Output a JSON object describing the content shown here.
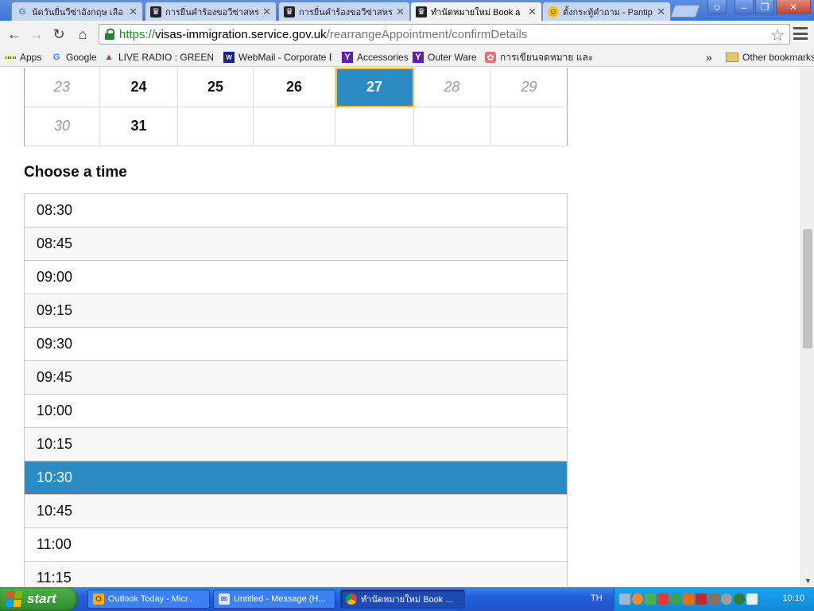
{
  "browser": {
    "tabs": [
      {
        "title": "นัดวันยื่นวีซ่าอังกฤษ เลือ",
        "icon": "google-icon"
      },
      {
        "title": "การยื่นคำร้องขอวีซ่าสหร",
        "icon": "crown-icon"
      },
      {
        "title": "การยื่นคำร้องขอวีซ่าสหร",
        "icon": "crown-icon"
      },
      {
        "title": "ทำนัดหมายใหม่ Book a",
        "icon": "crown-icon"
      },
      {
        "title": "ตั้งกระทู้คำถาม - Pantip",
        "icon": "emoji-icon"
      }
    ],
    "window_controls": {
      "minimize": "–",
      "maximize": "❐",
      "close": "✕"
    },
    "url": {
      "scheme": "https://",
      "host": "visas-immigration.service.gov.uk",
      "path": "/rearrangeAppointment/confirmDetails"
    },
    "bookmarks": [
      {
        "label": "Apps"
      },
      {
        "label": "Google"
      },
      {
        "label": "LIVE RADIO : GREEN W/"
      },
      {
        "label": "WebMail - Corporate Edi"
      },
      {
        "label": "Accessories"
      },
      {
        "label": "Outer Ware"
      },
      {
        "label": "การเขียนจดหมาย และอีเม"
      }
    ],
    "bookmarks_overflow": "»",
    "other_bookmarks": "Other bookmarks"
  },
  "calendar": {
    "rows": [
      [
        {
          "day": "23",
          "state": "off"
        },
        {
          "day": "24",
          "state": "on"
        },
        {
          "day": "25",
          "state": "on"
        },
        {
          "day": "26",
          "state": "on"
        },
        {
          "day": "27",
          "state": "selected"
        },
        {
          "day": "28",
          "state": "off"
        },
        {
          "day": "29",
          "state": "off"
        }
      ],
      [
        {
          "day": "30",
          "state": "off"
        },
        {
          "day": "31",
          "state": "on"
        },
        {
          "day": "",
          "state": "empty"
        },
        {
          "day": "",
          "state": "empty"
        },
        {
          "day": "",
          "state": "empty"
        },
        {
          "day": "",
          "state": "empty"
        },
        {
          "day": "",
          "state": "empty"
        }
      ]
    ]
  },
  "time_section": {
    "heading": "Choose a time",
    "slots": [
      "08:30",
      "08:45",
      "09:00",
      "09:15",
      "09:30",
      "09:45",
      "10:00",
      "10:15",
      "10:30",
      "10:45",
      "11:00",
      "11:15"
    ],
    "selected": "10:30"
  },
  "taskbar": {
    "start_label": "start",
    "tasks": [
      {
        "label": "Outlook Today - Micr...",
        "icon": "outlook-icon"
      },
      {
        "label": "Untitled - Message (H...",
        "icon": "message-icon"
      },
      {
        "label": "ทำนัดหมายใหม่ Book ...",
        "icon": "chrome-icon"
      }
    ],
    "language": "TH",
    "clock": "10:10"
  },
  "colors": {
    "selected_blue": "#2b8cc4",
    "focus_yellow": "#ffbf47",
    "https_green": "#1e8a2a"
  }
}
